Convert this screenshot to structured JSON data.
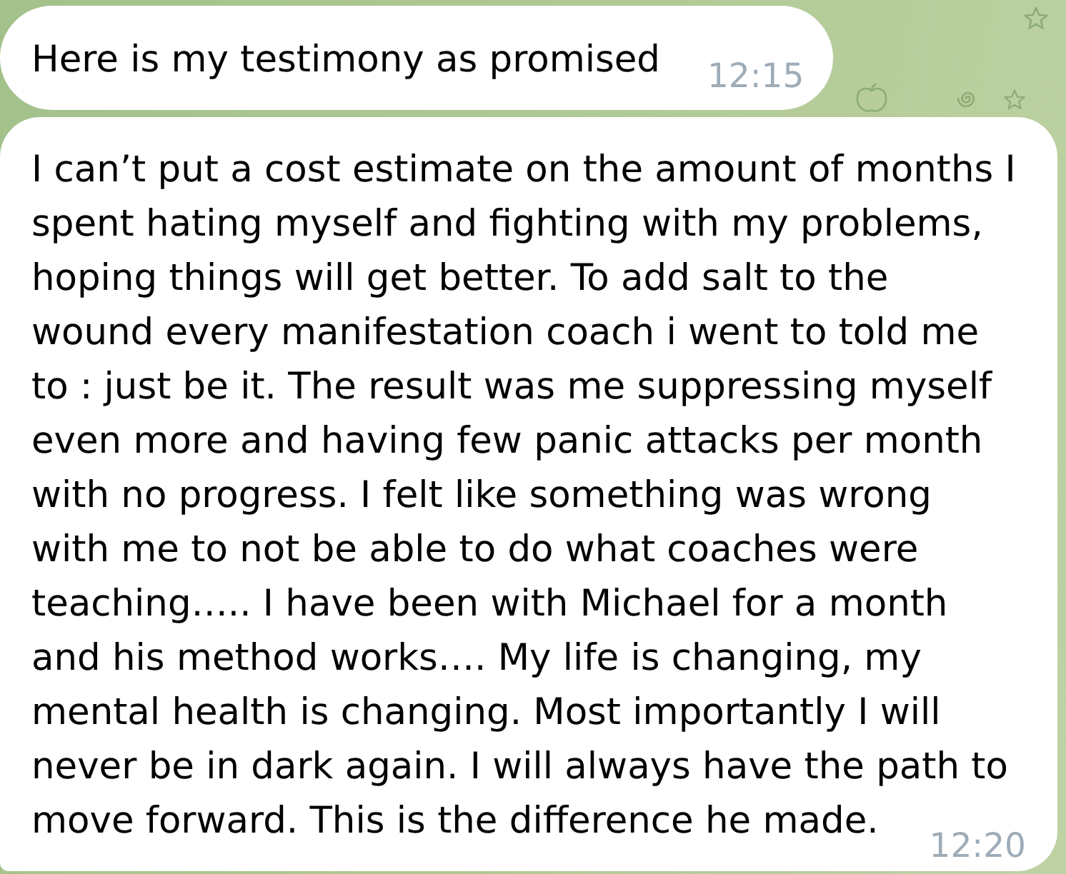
{
  "messages": [
    {
      "text": "Here is my testimony as promised",
      "time": "12:15"
    },
    {
      "text": "I can’t put a cost estimate on the amount of months I\nspent hating myself and fighting with my problems,\nhoping things will get better. To add salt to the\nwound every manifestation coach i went to told me\nto : just be it. The result was me suppressing myself\neven more and having few panic attacks per month\nwith no progress. I felt like something was wrong\nwith me to not be able to do what coaches were\nteaching….. I have been with Michael for a month\nand his method works…. My life is changing, my\nmental health is changing. Most importantly I will\nnever be in dark again. I will always have the path to\nmove forward. This is the difference he made.",
      "time": "12:20"
    }
  ]
}
